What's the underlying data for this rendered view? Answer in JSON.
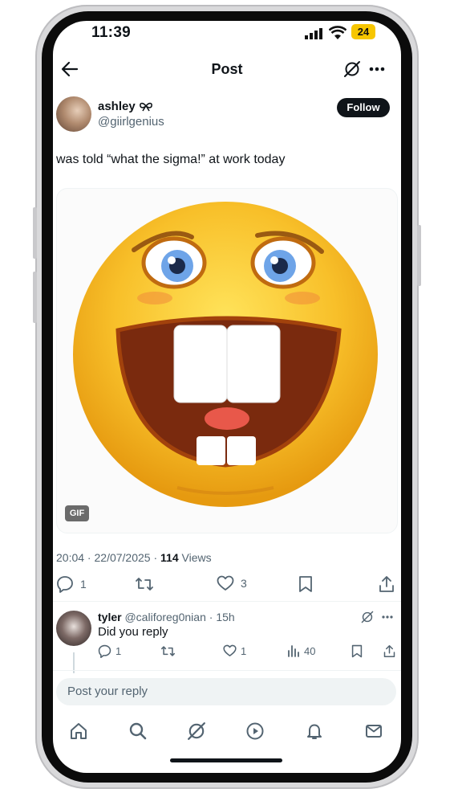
{
  "status_bar": {
    "time": "11:39",
    "battery": "24"
  },
  "nav": {
    "title": "Post"
  },
  "post": {
    "author_name": "ashley ",
    "author_handle": "@giirlgenius",
    "follow_label": "Follow",
    "text": "was told “what the sigma!” at work today",
    "media_badge": "GIF",
    "time": "20:04",
    "date": "22/07/2025",
    "views_count": "114",
    "views_label": "Views",
    "replies": "1",
    "likes": "3"
  },
  "reply": {
    "name": "tyler",
    "handle": "@califoreg0nian",
    "time": "15h",
    "text": "Did you reply",
    "replies": "1",
    "likes": "1",
    "views": "40"
  },
  "composer": {
    "placeholder": "Post your reply"
  },
  "colors": {
    "accent": "#0f1419",
    "secondary_text": "#536471",
    "battery": "#f7c600"
  },
  "icons": [
    "back-arrow-icon",
    "grok-icon",
    "more-icon",
    "reply-icon",
    "retweet-icon",
    "like-icon",
    "bookmark-icon",
    "share-icon",
    "views-icon",
    "home-icon",
    "search-icon",
    "notifications-icon",
    "messages-icon",
    "video-icon"
  ]
}
